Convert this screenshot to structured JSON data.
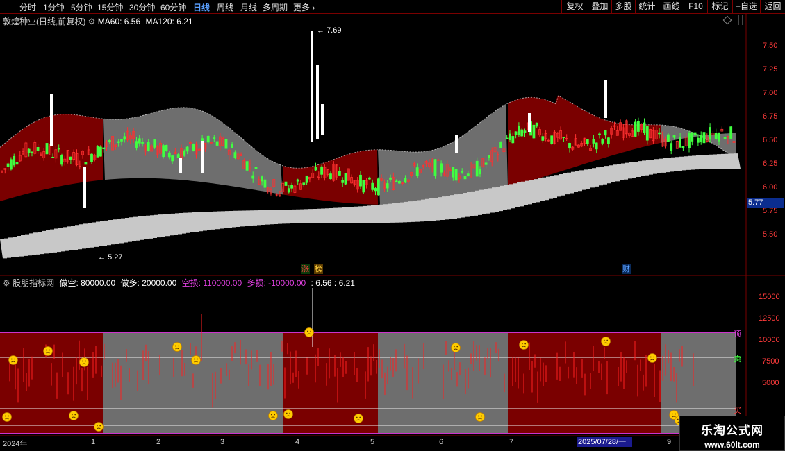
{
  "toolbar": {
    "periods": [
      "分时",
      "1分钟",
      "5分钟",
      "15分钟",
      "30分钟",
      "60分钟",
      "日线",
      "周线",
      "月线",
      "多周期",
      "更多"
    ],
    "active_period": "日线",
    "right_buttons": [
      "复权",
      "叠加",
      "多股",
      "统计",
      "画线",
      "F10",
      "标记",
      "+自选",
      "返回"
    ]
  },
  "main_chart": {
    "stock_title": "敦煌种业(日线,前复权)",
    "ma60_label": "MA60: 6.56",
    "ma120_label": "MA120: 6.21",
    "high_label": "7.69",
    "low_label": "5.27",
    "current_price": "5.77",
    "price_axis": [
      "7.50",
      "7.25",
      "7.00",
      "6.75",
      "6.50",
      "6.25",
      "6.00",
      "5.75",
      "5.50"
    ],
    "event_tags": [
      "涨",
      "榜",
      "财"
    ]
  },
  "indicator": {
    "name": "股朋指标网",
    "short_label": "做空: 80000.00",
    "long_label": "做多: 20000.00",
    "short_loss_label": "空损: 110000.00",
    "long_loss_label": "多损: -10000.00",
    "values_label": ": 6.56  : 6.21",
    "axis": [
      "15000",
      "12500",
      "10000",
      "7500",
      "5000"
    ],
    "level_labels": [
      "顶",
      "卖",
      "买"
    ]
  },
  "date_axis": {
    "labels": [
      "2024年",
      "1",
      "2",
      "3",
      "4",
      "5",
      "6",
      "7",
      "9"
    ],
    "cursor_date": "2025/07/28/一"
  },
  "watermark": {
    "title": "乐淘公式网",
    "url": "www.60lt.com"
  },
  "colors": {
    "up": "#ff3030",
    "down": "#40ff40",
    "band_red": "#7a0000",
    "band_gray": "#6e6e6e",
    "ribbon": "#c8c8c8",
    "magenta": "#cc33cc"
  }
}
